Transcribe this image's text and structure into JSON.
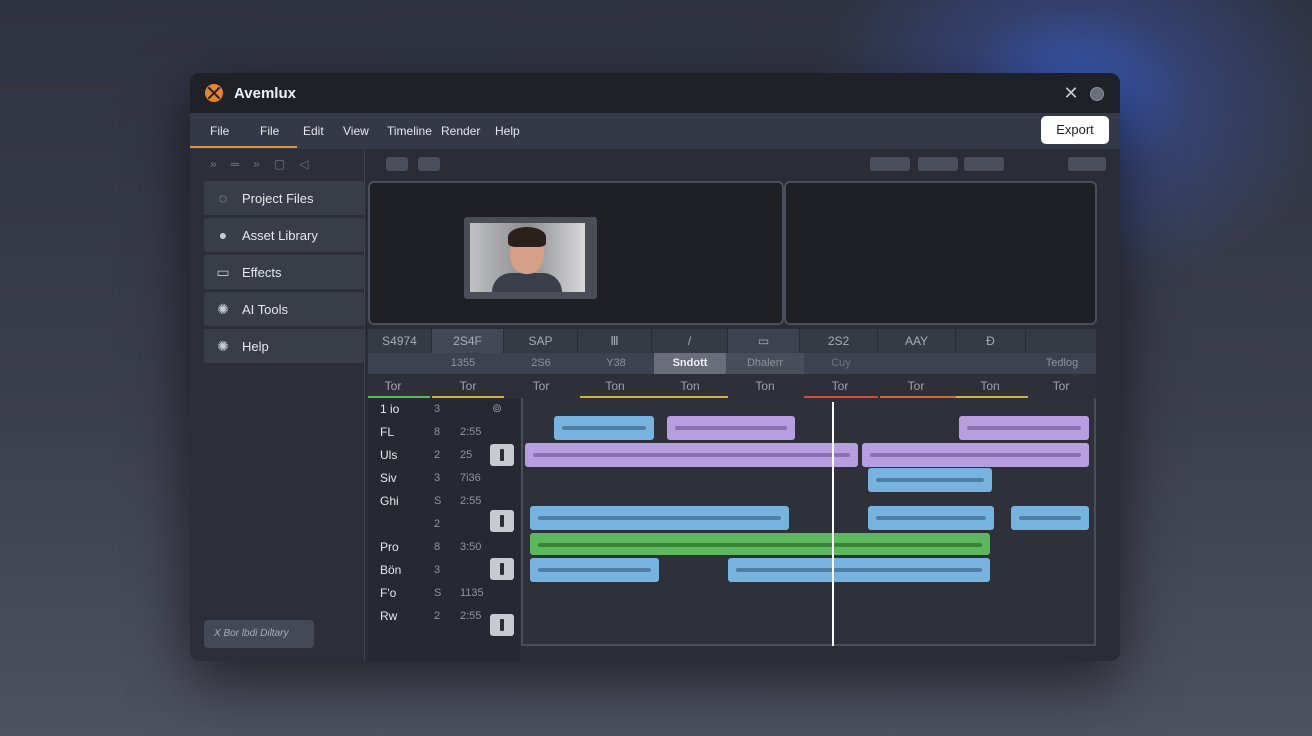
{
  "app": {
    "title": "Avemlux"
  },
  "menu": {
    "items": [
      "File",
      "File",
      "Edit",
      "View",
      "Timeline",
      "Render",
      "Help"
    ],
    "export_label": "Export"
  },
  "sidebar": {
    "tools": [
      "»",
      "═",
      "»",
      "▢",
      "◁"
    ],
    "items": [
      {
        "label": "Project Files",
        "icon": "folder-cloud-icon"
      },
      {
        "label": "Asset Library",
        "icon": "asset-icon"
      },
      {
        "label": "Effects",
        "icon": "effects-icon"
      },
      {
        "label": "AI Tools",
        "icon": "ai-icon"
      },
      {
        "label": "Help",
        "icon": "help-icon"
      }
    ],
    "bottom_button": "X Bor lbdi Diltary"
  },
  "track_headers": [
    "S4974",
    "2S4F",
    "SAP",
    "Ⅲ",
    "/",
    "▭",
    "2S2",
    "AAY",
    "Ð"
  ],
  "sub_row": [
    "1355",
    "2S6",
    "Y38",
    "Sndott",
    "Dhalerr",
    "Cuy",
    "Tedlog"
  ],
  "ruler": [
    "Tor",
    "Tor",
    "Tor",
    "Ton",
    "Ton",
    "Ton",
    "Tor",
    "Tor",
    "Ton",
    "Tor"
  ],
  "tracks": [
    {
      "name": "1 io",
      "num": "3",
      "time": ""
    },
    {
      "name": "FL",
      "num": "8",
      "time": "2:55"
    },
    {
      "name": "Uls",
      "num": "2",
      "time": "25"
    },
    {
      "name": "Siv",
      "num": "3",
      "time": "7i36"
    },
    {
      "name": "Ghi",
      "num": "S",
      "time": "2:55"
    },
    {
      "name": "",
      "num": "2",
      "time": ""
    },
    {
      "name": "Pro",
      "num": "8",
      "time": "3:50"
    },
    {
      "name": "Bön",
      "num": "3",
      "time": ""
    },
    {
      "name": "F'o",
      "num": "S",
      "time": "1135"
    },
    {
      "name": "Rw",
      "num": "2",
      "time": "2:55"
    }
  ],
  "colors": {
    "accent": "#e0953a",
    "blue_clip": "#76b3de",
    "purple_clip": "#b69ee0",
    "green_clip": "#5cb85c"
  }
}
